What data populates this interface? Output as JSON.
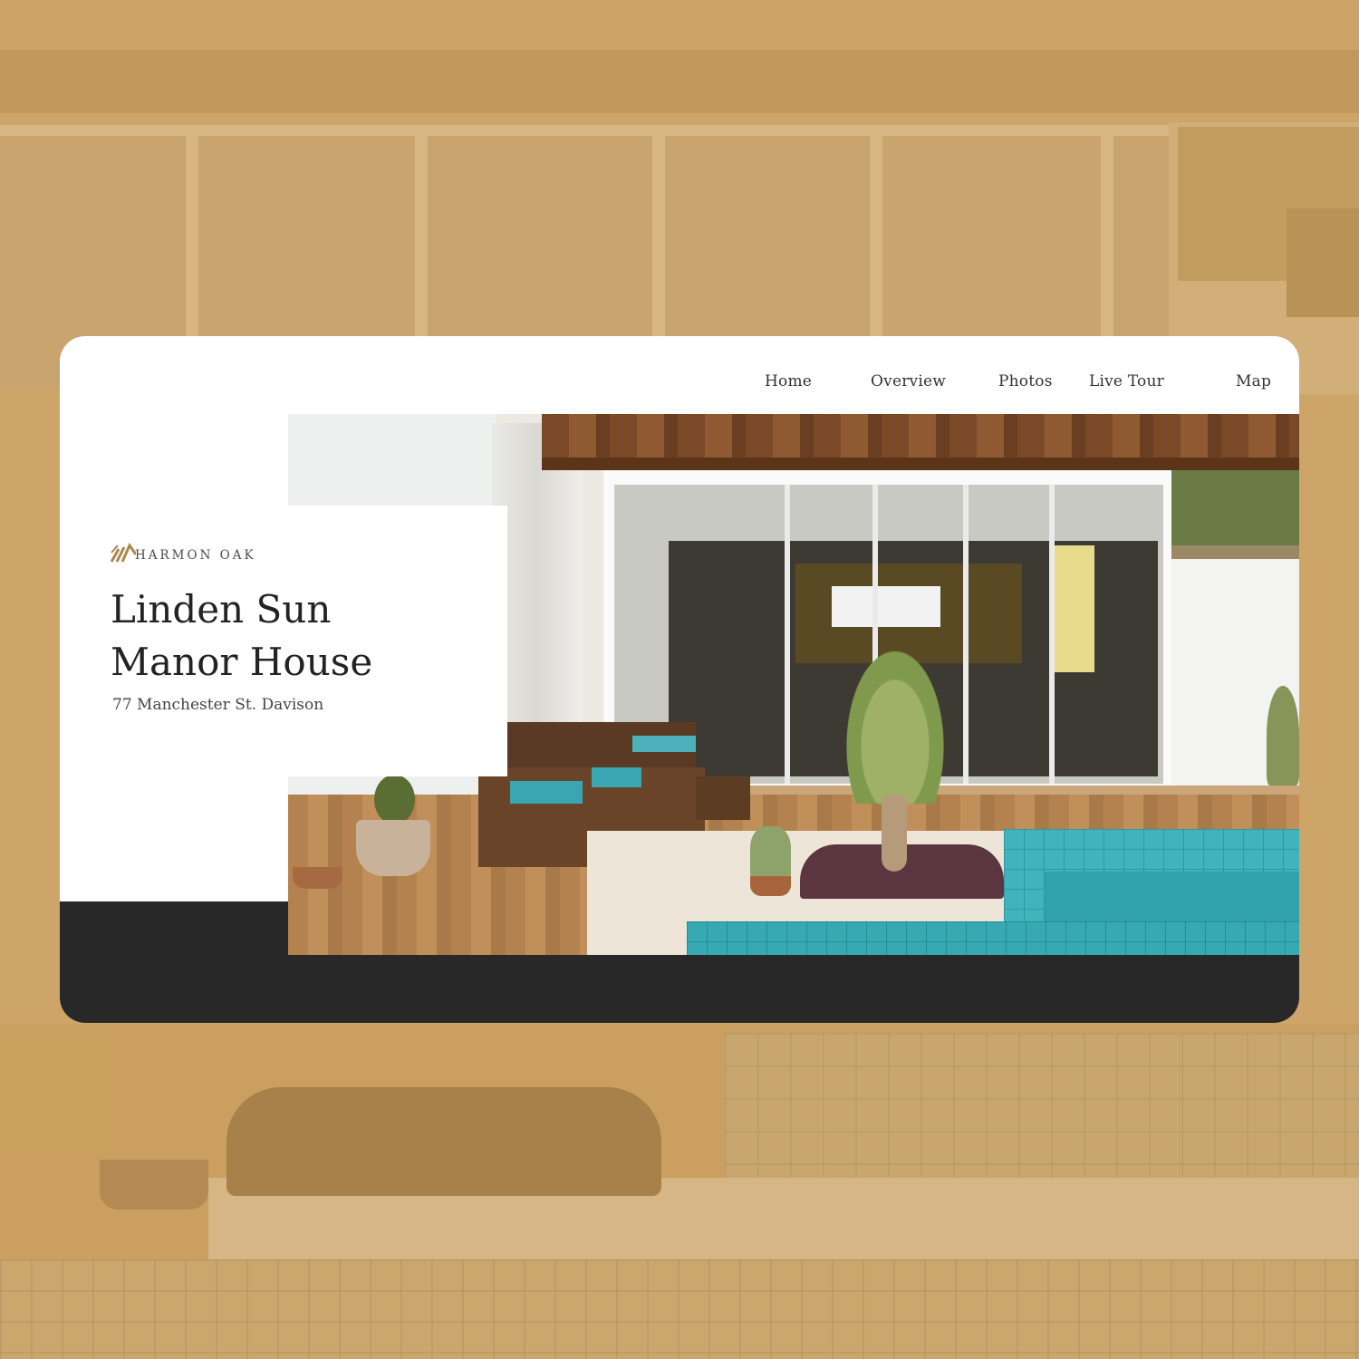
{
  "nav": {
    "items": [
      {
        "label": "Home"
      },
      {
        "label": "Overview"
      },
      {
        "label": "Photos"
      },
      {
        "label": "Live Tour"
      },
      {
        "label": "Map"
      }
    ]
  },
  "brand": {
    "name": "HARMON OAK",
    "logo_icon": "roof-lines-icon",
    "logo_color": "#a8884f"
  },
  "listing": {
    "title_line1": "Linden Sun",
    "title_line2": "Manor House",
    "address": "77 Manchester St. Davison"
  },
  "colors": {
    "backdrop": "#caa46a",
    "card": "#ffffff",
    "footer_bar": "#282828",
    "text_dark": "#232323"
  }
}
